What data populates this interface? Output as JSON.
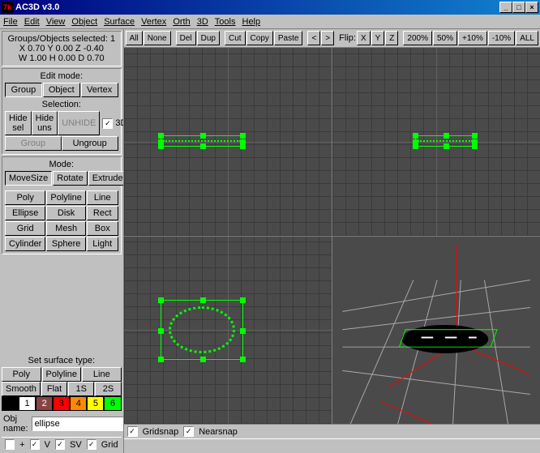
{
  "title": "AC3D v3.0",
  "titlebar_icon": "7k",
  "menubar": [
    "File",
    "Edit",
    "View",
    "Object",
    "Surface",
    "Vertex",
    "Orth",
    "3D",
    "Tools",
    "Help"
  ],
  "info": {
    "selected": "Groups/Objects selected: 1",
    "coords": "X 0.70 Y 0.00 Z -0.40",
    "dims": "W 1.00 H 0.00 D 0.70"
  },
  "edit_mode": {
    "title": "Edit mode:",
    "group": "Group",
    "object": "Object",
    "vertex": "Vertex"
  },
  "selection": {
    "title": "Selection:",
    "hide_sel": "Hide sel",
    "hide_uns": "Hide uns",
    "unhide": "UNHIDE",
    "threeD": "3D",
    "group": "Group",
    "ungroup": "Ungroup"
  },
  "mode": {
    "title": "Mode:",
    "movesize": "MoveSize",
    "rotate": "Rotate",
    "extrude": "Extrude",
    "poly": "Poly",
    "polyline": "Polyline",
    "line": "Line",
    "ellipse": "Ellipse",
    "disk": "Disk",
    "rect": "Rect",
    "grid": "Grid",
    "mesh": "Mesh",
    "box": "Box",
    "cylinder": "Cylinder",
    "sphere": "Sphere",
    "light": "Light"
  },
  "surface": {
    "title": "Set surface type:",
    "poly": "Poly",
    "polyline": "Polyline",
    "line": "Line",
    "smooth": "Smooth",
    "flat": "Flat",
    "s1": "1S",
    "s2": "2S"
  },
  "colors": [
    {
      "bg": "#000000",
      "label": ""
    },
    {
      "bg": "#ffffff",
      "label": "1"
    },
    {
      "bg": "#884444",
      "label": "2"
    },
    {
      "bg": "#ff0000",
      "label": "3"
    },
    {
      "bg": "#ff8800",
      "label": "4"
    },
    {
      "bg": "#ffff00",
      "label": "5"
    },
    {
      "bg": "#00ff00",
      "label": "6"
    }
  ],
  "obj_name_label": "Obj name:",
  "obj_name_value": "ellipse",
  "bottom": {
    "plus": "+",
    "v": "V",
    "sv": "SV",
    "grid": "Grid",
    "gridsnap": "Gridsnap",
    "nearsnap": "Nearsnap"
  },
  "toolbar": {
    "all": "All",
    "none": "None",
    "del": "Del",
    "dup": "Dup",
    "cut": "Cut",
    "copy": "Copy",
    "paste": "Paste",
    "lt": ">",
    "gt": "<",
    "flip": "Flip:",
    "x": "X",
    "y": "Y",
    "z": "Z",
    "z200": "200%",
    "z50": "50%",
    "zp10": "+10%",
    "zm10": "-10%",
    "zall": "ALL"
  }
}
